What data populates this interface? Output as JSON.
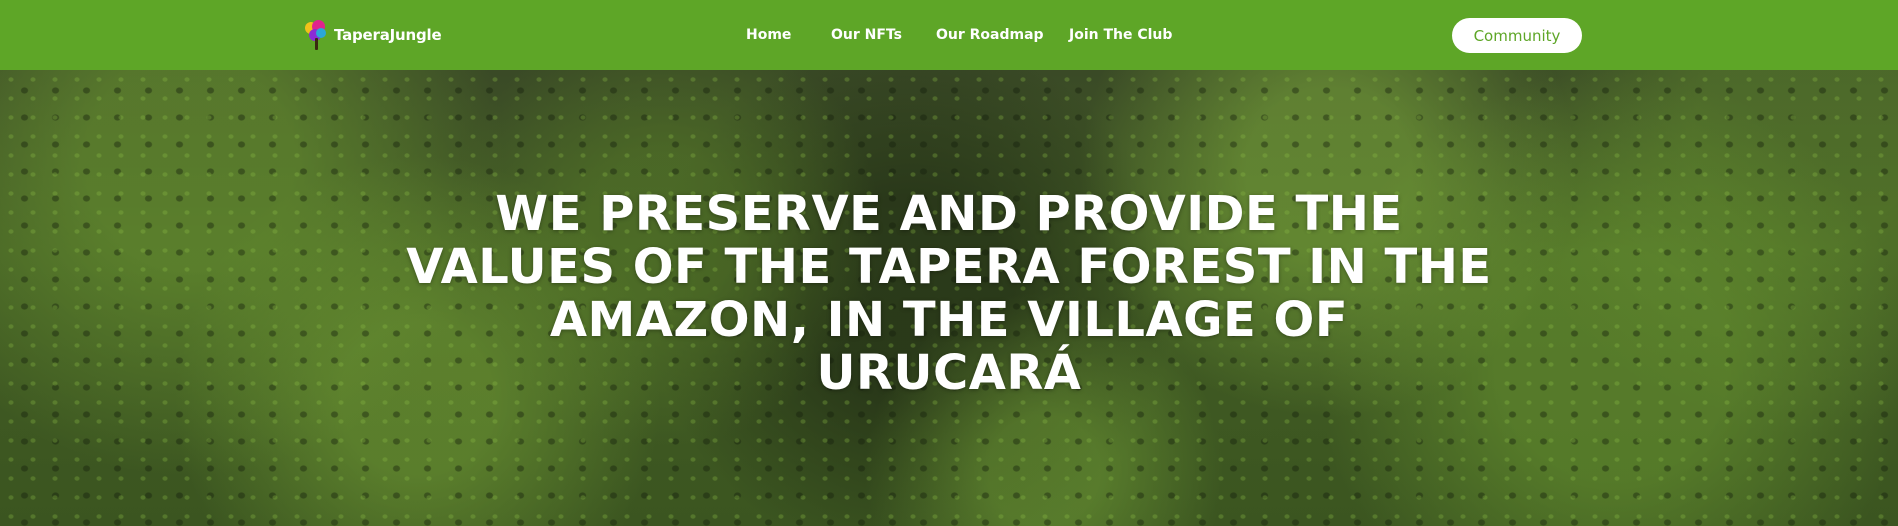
{
  "brand": {
    "name": "TaperaJungle",
    "logo_icon": "tree-icon"
  },
  "nav": {
    "items": [
      "Home",
      "Our NFTs",
      "Our Roadmap",
      "Join The Club"
    ]
  },
  "cta": {
    "label": "Community"
  },
  "hero": {
    "title_lines": [
      "WE PRESERVE AND PROVIDE THE",
      "VALUES OF THE TAPERA FOREST IN THE",
      "AMAZON, IN THE VILLAGE OF",
      "URUCARÁ"
    ]
  },
  "colors": {
    "header": "#5ea627",
    "cta_text": "#5ea627"
  }
}
